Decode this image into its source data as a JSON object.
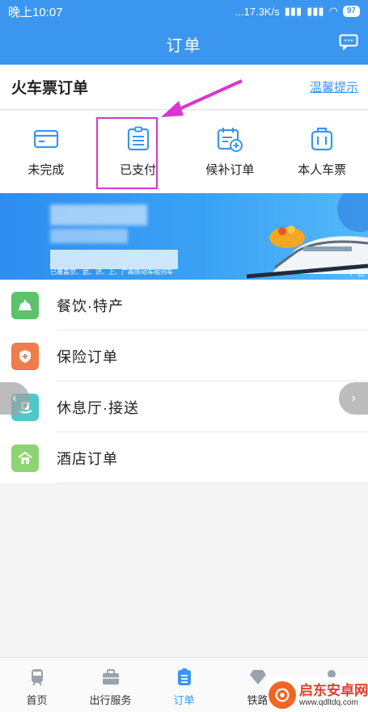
{
  "status_bar": {
    "time": "晚上10:07",
    "network": "...17.3K/s",
    "battery": "97"
  },
  "nav": {
    "title": "订单"
  },
  "section": {
    "title": "火车票订单",
    "tip_link": "温馨提示"
  },
  "quick_actions": [
    {
      "label": "未完成",
      "icon": "card-icon"
    },
    {
      "label": "已支付",
      "icon": "receipt-icon"
    },
    {
      "label": "候补订单",
      "icon": "calendar-plus-icon"
    },
    {
      "label": "本人车票",
      "icon": "ticket-icon"
    }
  ],
  "banner": {
    "caption": "已覆盖京、武、济、上、广高铁动车组列车",
    "ad_label": "广告"
  },
  "services": [
    {
      "label": "餐饮·特产",
      "icon": "food-bell-icon",
      "color": "#5cc26b"
    },
    {
      "label": "保险订单",
      "icon": "shield-icon",
      "color": "#f07c4a"
    },
    {
      "label": "休息厅·接送",
      "icon": "lounge-icon",
      "color": "#4fc8c8"
    },
    {
      "label": "酒店订单",
      "icon": "hotel-icon",
      "color": "#8fd472"
    }
  ],
  "tabs": [
    {
      "label": "首页",
      "icon": "train-icon",
      "active": false
    },
    {
      "label": "出行服务",
      "icon": "briefcase-icon",
      "active": false
    },
    {
      "label": "订单",
      "icon": "order-icon",
      "active": true
    },
    {
      "label": "铁路",
      "icon": "diamond-icon",
      "active": false
    }
  ],
  "watermark": {
    "title": "启东安卓网",
    "url": "www.qdltdq.com"
  },
  "colors": {
    "primary": "#3b96ef",
    "highlight": "#d935d2"
  }
}
